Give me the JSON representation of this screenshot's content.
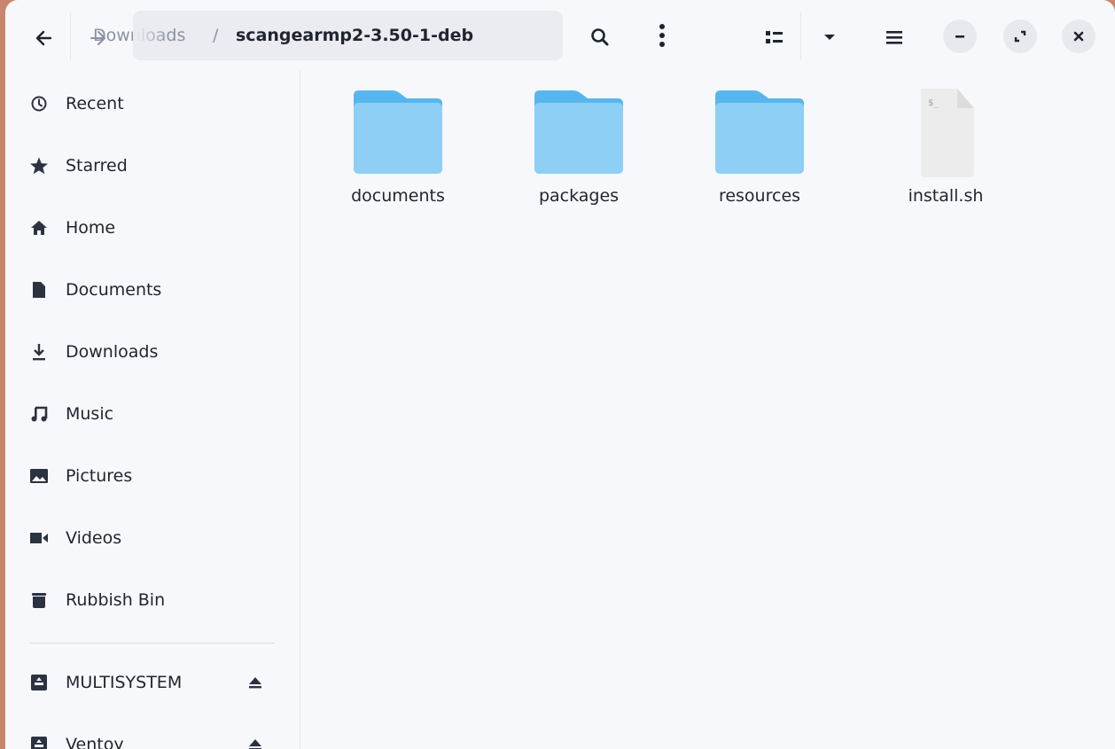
{
  "header": {
    "back_icon": "arrow-left-icon",
    "forward_icon": "arrow-right-icon",
    "path_previous": "Downloads",
    "path_separator": "/",
    "path_current": "scangearmp2-3.50-1-deb",
    "path_menu_icon": "vertical-dots-icon",
    "search_icon": "search-icon",
    "view_icon": "list-view-icon",
    "view_dropdown_icon": "chevron-down-icon",
    "menu_icon": "hamburger-menu-icon",
    "minimize_icon": "minimize-icon",
    "maximize_icon": "maximize-icon",
    "close_icon": "close-icon"
  },
  "sidebar": {
    "places": [
      {
        "label": "Recent",
        "icon": "clock-icon"
      },
      {
        "label": "Starred",
        "icon": "star-icon"
      },
      {
        "label": "Home",
        "icon": "home-icon"
      },
      {
        "label": "Documents",
        "icon": "document-icon"
      },
      {
        "label": "Downloads",
        "icon": "download-icon"
      },
      {
        "label": "Music",
        "icon": "music-icon"
      },
      {
        "label": "Pictures",
        "icon": "picture-icon"
      },
      {
        "label": "Videos",
        "icon": "video-icon"
      },
      {
        "label": "Rubbish Bin",
        "icon": "trash-icon"
      }
    ],
    "devices": [
      {
        "label": "MULTISYSTEM",
        "icon": "drive-icon",
        "eject_icon": "eject-icon"
      },
      {
        "label": "Ventoy",
        "icon": "drive-icon",
        "eject_icon": "eject-icon"
      }
    ]
  },
  "files": [
    {
      "name": "documents",
      "type": "folder"
    },
    {
      "name": "packages",
      "type": "folder"
    },
    {
      "name": "resources",
      "type": "folder"
    },
    {
      "name": "install.sh",
      "type": "script"
    }
  ],
  "colors": {
    "folder": "#8dcff5",
    "folder_tab": "#58b6ee",
    "script_file": "#ececec"
  }
}
